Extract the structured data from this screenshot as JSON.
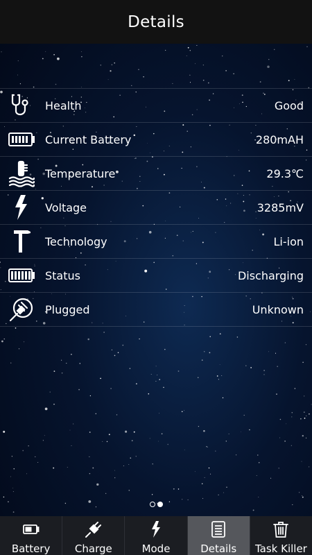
{
  "header": {
    "title": "Details"
  },
  "details": [
    {
      "icon": "stethoscope-icon",
      "label": "Health",
      "value": "Good"
    },
    {
      "icon": "battery-icon",
      "label": "Current Battery",
      "value": "280mAH"
    },
    {
      "icon": "thermometer-icon",
      "label": "Temperature",
      "value": "29.3℃"
    },
    {
      "icon": "lightning-icon",
      "label": "Voltage",
      "value": "3285mV"
    },
    {
      "icon": "hammer-icon",
      "label": "Technology",
      "value": "Li-ion"
    },
    {
      "icon": "battery-full-icon",
      "label": "Status",
      "value": "Discharging"
    },
    {
      "icon": "plug-icon",
      "label": "Plugged",
      "value": "Unknown"
    }
  ],
  "pager": {
    "count": 2,
    "active_index": 1
  },
  "tabs": [
    {
      "icon": "battery-tab-icon",
      "label": "Battery"
    },
    {
      "icon": "plug-tab-icon",
      "label": "Charge"
    },
    {
      "icon": "lightning-tab-icon",
      "label": "Mode"
    },
    {
      "icon": "document-tab-icon",
      "label": "Details",
      "selected": true
    },
    {
      "icon": "trash-tab-icon",
      "label": "Task Killer"
    }
  ]
}
